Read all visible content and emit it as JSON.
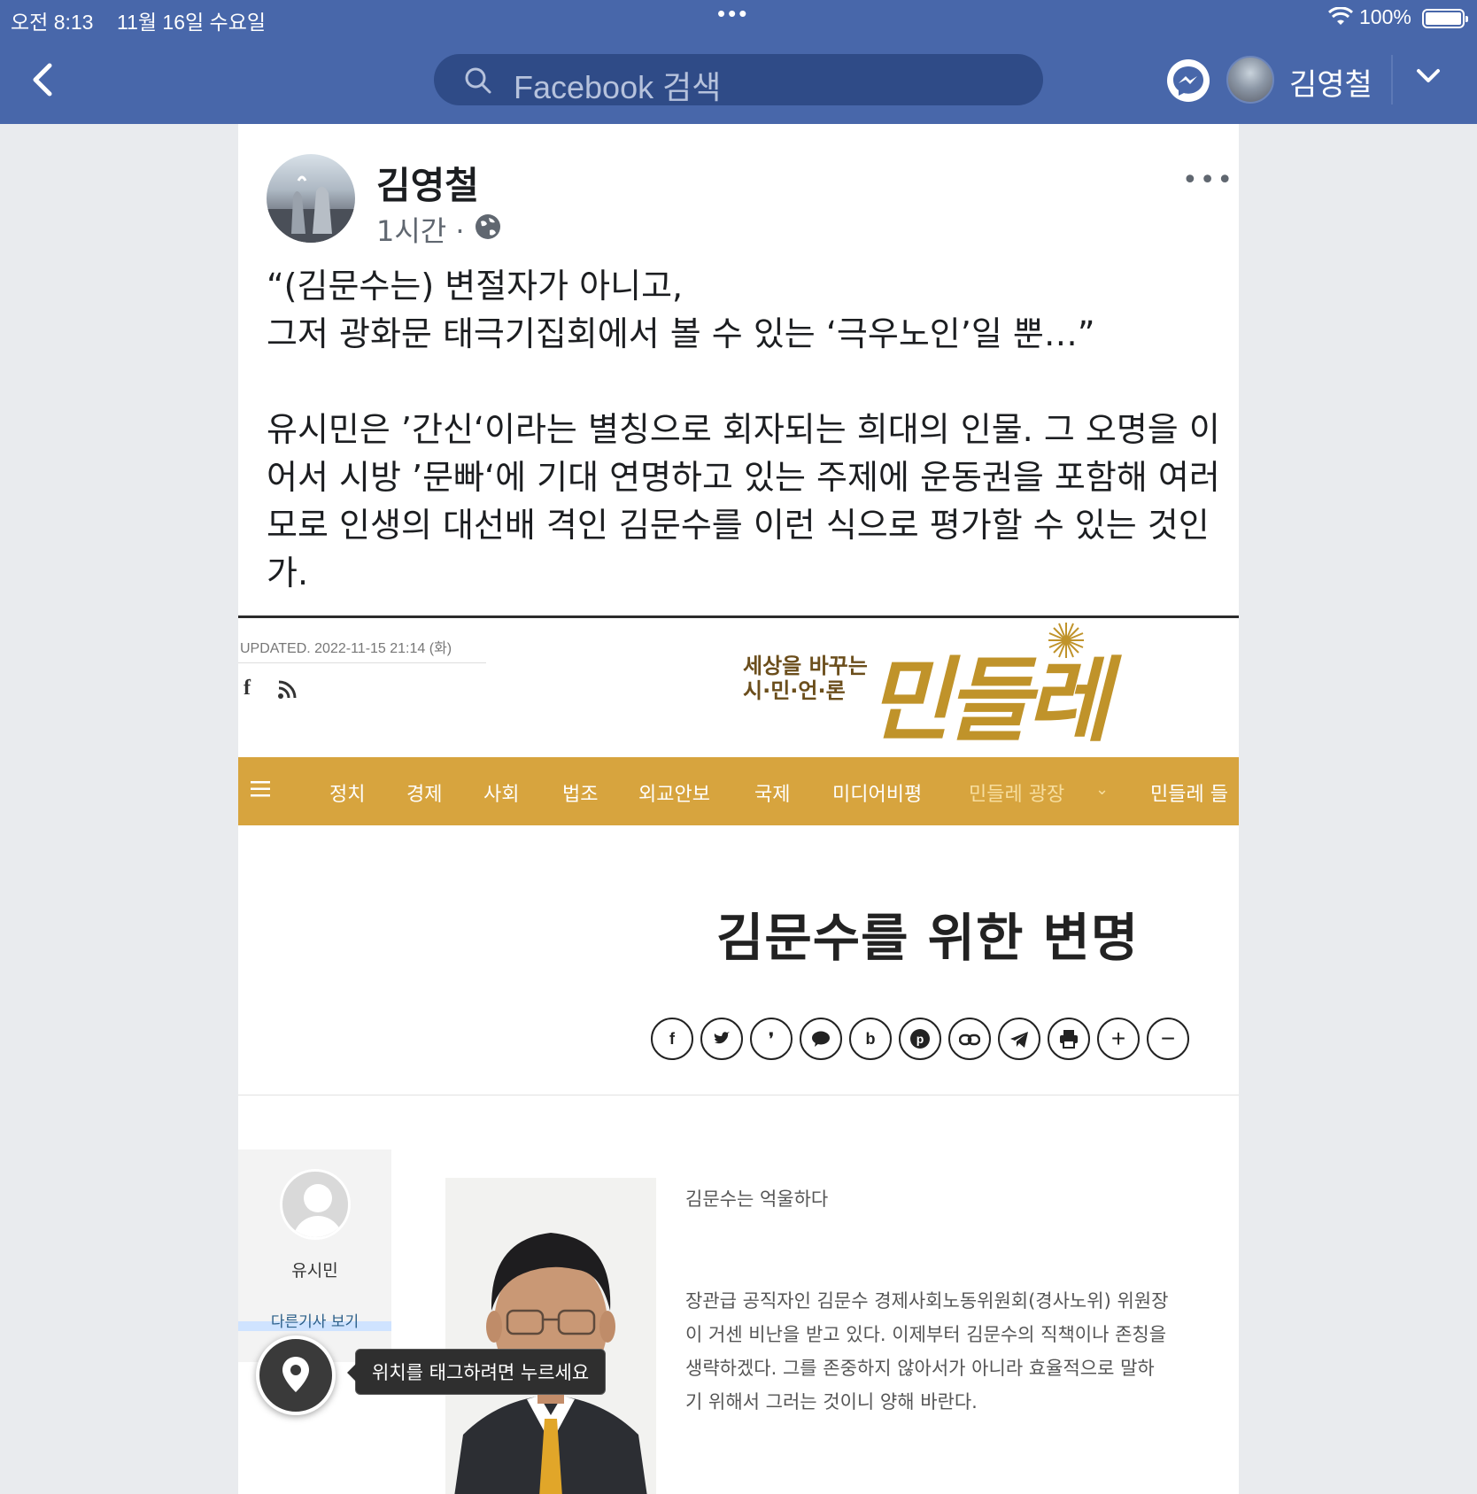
{
  "status_bar": {
    "time": "오전 8:13",
    "date": "11월 16일 수요일",
    "battery": "100%"
  },
  "header": {
    "search_placeholder": "Facebook 검색",
    "user_name": "김영철",
    "color": "#4867aa"
  },
  "post": {
    "author": "김영철",
    "time": "1시간",
    "separator": "·",
    "more": "•••",
    "paragraphs": [
      "“(김문수는) 변절자가 아니고,\n그저 광화문 태극기집회에서 볼 수 있는 ‘극우노인’일 뿐…”",
      "유시민은 ’간신‘이라는 별칭으로 회자되는 희대의 인물. 그 오명을 이어서 시방 ’문빠‘에 기대 연명하고 있는 주제에 운동권을 포함해 여러모로 인생의 대선배 격인 김문수를 이런 식으로 평가할 수 있는 것인가."
    ]
  },
  "embed": {
    "updated": "UPDATED. 2022-11-15 21:14 (화)",
    "logo_sub_1": "세상을 바꾸는",
    "logo_sub_2": "시·민·언·론",
    "logo_main": "민들레",
    "nav_color": "#d7a43e",
    "nav_items": [
      "정치",
      "경제",
      "사회",
      "법조",
      "외교안보",
      "국제",
      "미디어비평",
      "민들레 광장",
      "민들레 들"
    ],
    "article_title": "김문수를 위한 변명",
    "share_icons": [
      "facebook-icon",
      "twitter-icon",
      "kakaostory-icon",
      "kakaotalk-icon",
      "band-icon",
      "pinterest-icon",
      "link-icon",
      "telegram-icon",
      "print-icon",
      "font-plus-icon",
      "font-minus-icon"
    ],
    "author_name": "유시민",
    "author_more": "다른기사 보기",
    "lead": "김문수는 억울하다",
    "body_lines": [
      "장관급 공직자인 김문수 경제사회노동위원회(경사노위) 위원장",
      "이 거센 비난을 받고 있다. 이제부터 김문수의 직책이나 존칭을",
      "생략하겠다. 그를 존중하지 않아서가 아니라 효율적으로 말하",
      "기 위해서 그러는 것이니 양해 바란다."
    ]
  },
  "location_tip": "위치를 태그하려면 누르세요"
}
